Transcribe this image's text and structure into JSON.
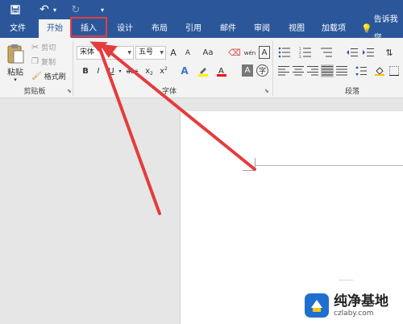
{
  "quick_access": {
    "undo_glyph": "↶",
    "redo_glyph": "↻",
    "dropdown_glyph": "▾"
  },
  "tabs": [
    {
      "label": "文件"
    },
    {
      "label": "开始"
    },
    {
      "label": "插入"
    },
    {
      "label": "设计"
    },
    {
      "label": "布局"
    },
    {
      "label": "引用"
    },
    {
      "label": "邮件"
    },
    {
      "label": "审阅"
    },
    {
      "label": "视图"
    },
    {
      "label": "加载项"
    }
  ],
  "tell_me": "告诉我您",
  "clipboard": {
    "paste_label": "粘贴",
    "cut_label": "剪切",
    "copy_label": "复制",
    "format_painter_label": "格式刷",
    "group_label": "剪贴板"
  },
  "font": {
    "font_name": "宋体",
    "font_size": "五号",
    "grow_label": "A",
    "shrink_label": "A",
    "case_label": "Aa",
    "pinyin_label": "wén",
    "bold_label": "B",
    "italic_label": "I",
    "underline_label": "U",
    "strike_label": "abc",
    "subscript_label": "x",
    "superscript_label": "x",
    "group_label": "字体"
  },
  "paragraph": {
    "group_label": "段落"
  },
  "watermark": {
    "title": "纯净基地",
    "url": "czlaby.com"
  },
  "colors": {
    "accent": "#2b579a",
    "highlight": "#e53c3c",
    "ribbon": "#f3f3f3"
  }
}
